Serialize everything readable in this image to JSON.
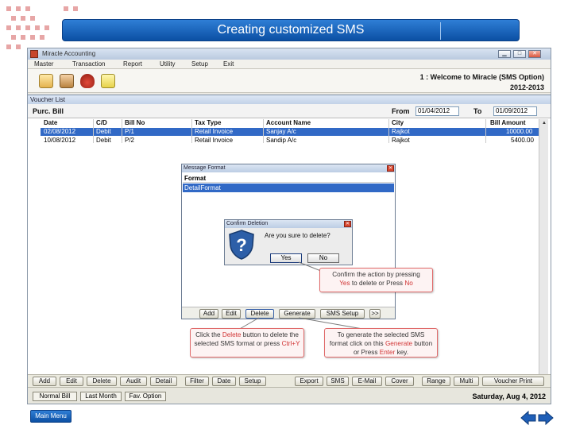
{
  "banner": {
    "title": "Creating customized SMS"
  },
  "window": {
    "title": "Miracle Accounting",
    "menu": [
      "Master",
      "Transaction",
      "Report",
      "Utility",
      "Setup",
      "Exit"
    ],
    "welcome_line1": "1 : Welcome to Miracle (SMS Option)",
    "welcome_line2": "2012-2013"
  },
  "voucher_list": {
    "title": "Voucher List",
    "filter_label": "Purc. Bill",
    "from_label": "From",
    "from_value": "01/04/2012",
    "to_label": "To",
    "to_value": "01/09/2012",
    "columns": [
      "Date",
      "C/D",
      "Bill No",
      "Tax Type",
      "Account Name",
      "City",
      "Bill Amount"
    ],
    "rows": [
      {
        "date": "02/08/2012",
        "cd": "Debit",
        "billno": "P/1",
        "tax": "Retail Invoice",
        "account": "Sanjay A/c",
        "city": "Rajkot",
        "amount": "10000.00"
      },
      {
        "date": "10/08/2012",
        "cd": "Debit",
        "billno": "P/2",
        "tax": "Retail Invoice",
        "account": "Sandip A/c",
        "city": "Rajkot",
        "amount": "5400.00"
      }
    ],
    "bottom_buttons": [
      "Add",
      "Edit",
      "Delete",
      "Audit",
      "Detail",
      "Filter",
      "Date",
      "Setup",
      "Export",
      "SMS",
      "E-Mail",
      "Cover",
      "Range",
      "Multi",
      "Voucher Print"
    ],
    "status_tabs": [
      "Normal Bill",
      "Last Month",
      "Fav. Option"
    ],
    "status_date": "Saturday, Aug 4, 2012"
  },
  "message_format": {
    "title": "Message Format",
    "column": "Format",
    "selected_row": "DetailFormat",
    "buttons": [
      "Add",
      "Edit",
      "Delete",
      "Generate",
      "SMS Setup",
      ">>"
    ]
  },
  "confirm_dialog": {
    "title": "Confirm Deletion",
    "message": "Are you sure to delete?",
    "yes_label": "Yes",
    "no_label": "No"
  },
  "callouts": {
    "confirm": {
      "text1": "Confirm the action by pressing",
      "yes": "Yes",
      "mid": "to delete or Press",
      "no": "No"
    },
    "delete": {
      "pre": "Click the",
      "key": "Delete",
      "post": "button to delete the selected SMS format or press",
      "shortcut": "Ctrl+Y"
    },
    "generate": {
      "pre": "To generate the selected SMS format click on this",
      "key": "Generate",
      "mid": "button or Press",
      "enter": "Enter",
      "post": "key."
    }
  },
  "footer": {
    "main_menu": "Main Menu"
  },
  "colors": {
    "selection": "#3169c6",
    "banner": "#0b4fa3",
    "callout_border": "#e06a6a"
  }
}
